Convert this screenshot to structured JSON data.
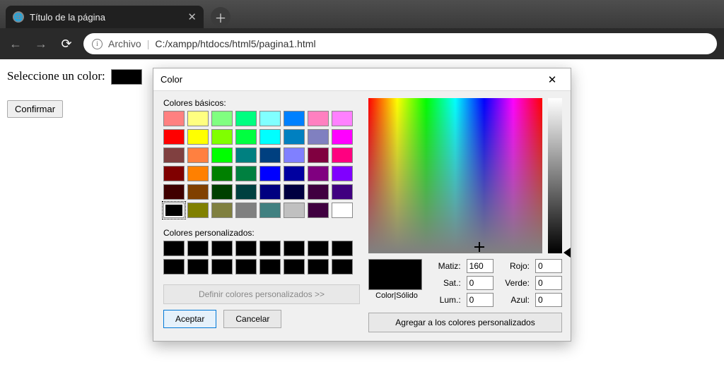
{
  "browser": {
    "tab_title": "Título de la página",
    "url_scheme": "Archivo",
    "url_path": "C:/xampp/htdocs/html5/pagina1.html"
  },
  "page": {
    "label": "Seleccione un color:",
    "confirm": "Confirmar"
  },
  "dialog": {
    "title": "Color",
    "basic_label": "Colores básicos:",
    "custom_label": "Colores personalizados:",
    "define_custom": "Definir colores personalizados >>",
    "accept": "Aceptar",
    "cancel": "Cancelar",
    "preview_label": "Color|Sólido",
    "hue_label": "Matiz:",
    "sat_label": "Sat.:",
    "lum_label": "Lum.:",
    "red_label": "Rojo:",
    "green_label": "Verde:",
    "blue_label": "Azul:",
    "add_custom": "Agregar a los colores personalizados",
    "values": {
      "hue": "160",
      "sat": "0",
      "lum": "0",
      "red": "0",
      "green": "0",
      "blue": "0"
    },
    "basic_colors": [
      "#ff8080",
      "#ffff80",
      "#80ff80",
      "#00ff80",
      "#80ffff",
      "#0080ff",
      "#ff80c0",
      "#ff80ff",
      "#ff0000",
      "#ffff00",
      "#80ff00",
      "#00ff40",
      "#00ffff",
      "#0080c0",
      "#8080c0",
      "#ff00ff",
      "#804040",
      "#ff8040",
      "#00ff00",
      "#008080",
      "#004080",
      "#8080ff",
      "#800040",
      "#ff0080",
      "#800000",
      "#ff8000",
      "#008000",
      "#008040",
      "#0000ff",
      "#0000a0",
      "#800080",
      "#8000ff",
      "#400000",
      "#804000",
      "#004000",
      "#004040",
      "#000080",
      "#000040",
      "#400040",
      "#400080",
      "#000000",
      "#808000",
      "#808040",
      "#808080",
      "#408080",
      "#c0c0c0",
      "#400040",
      "#ffffff"
    ],
    "custom_colors": [
      "#000000",
      "#000000",
      "#000000",
      "#000000",
      "#000000",
      "#000000",
      "#000000",
      "#000000",
      "#000000",
      "#000000",
      "#000000",
      "#000000",
      "#000000",
      "#000000",
      "#000000",
      "#000000"
    ]
  }
}
